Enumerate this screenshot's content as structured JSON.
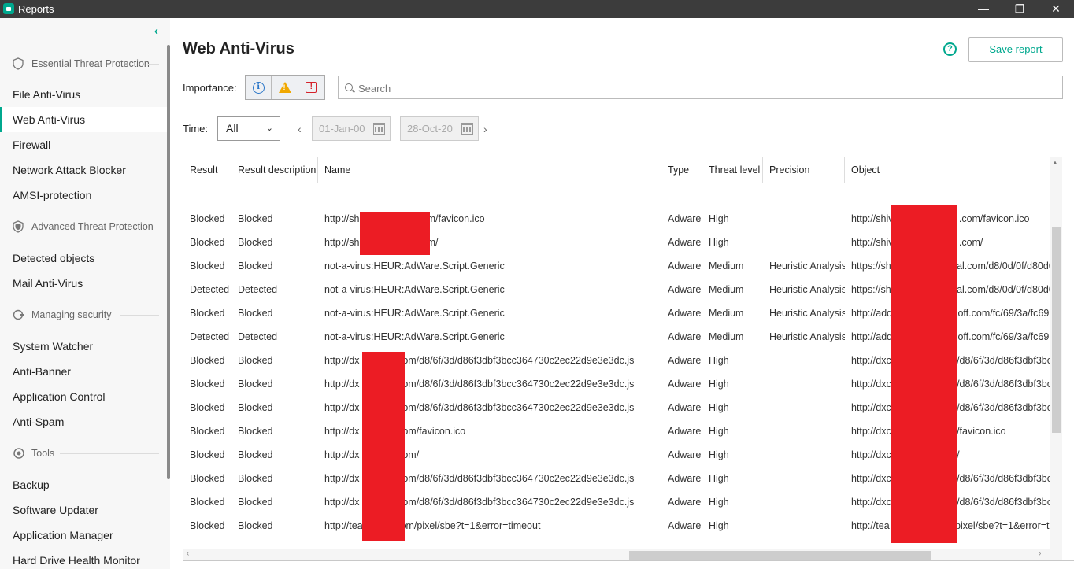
{
  "window": {
    "title": "Reports"
  },
  "sidebar": {
    "sections": [
      {
        "label": "Essential Threat Protection",
        "items": [
          "File Anti-Virus",
          "Web Anti-Virus",
          "Firewall",
          "Network Attack Blocker",
          "AMSI-protection"
        ]
      },
      {
        "label": "Advanced Threat Protection",
        "items": [
          "Detected objects",
          "Mail Anti-Virus"
        ]
      },
      {
        "label": "Managing security",
        "items": [
          "System Watcher",
          "Anti-Banner",
          "Application Control",
          "Anti-Spam"
        ]
      },
      {
        "label": "Tools",
        "items": [
          "Backup",
          "Software Updater",
          "Application Manager",
          "Hard Drive Health Monitor"
        ]
      }
    ],
    "active_item": "Web Anti-Virus"
  },
  "main": {
    "title": "Web Anti-Virus",
    "save_label": "Save report",
    "importance_label": "Importance:",
    "search_placeholder": "Search",
    "time_label": "Time:",
    "time_value": "All",
    "date_from": "01-Jan-00",
    "date_to": "28-Oct-20"
  },
  "table": {
    "columns": [
      "Result",
      "Result description",
      "Name",
      "Type",
      "Threat level",
      "Precision",
      "Object"
    ],
    "rows": [
      [
        "Blocked",
        "Blocked",
        "http://sh                    .com/favicon.ico",
        "Adware",
        "High",
        "",
        "http://shiv                        .com/favicon.ico"
      ],
      [
        "Blocked",
        "Blocked",
        "http://sh                    .com/",
        "Adware",
        "High",
        "",
        "http://shiv                        .com/"
      ],
      [
        "Blocked",
        "Blocked",
        "not-a-virus:HEUR:AdWare.Script.Generic",
        "Adware",
        "Medium",
        "Heuristic Analysis",
        "https://sh                        al.com/d8/0d/0f/d80d0"
      ],
      [
        "Detected",
        "Detected",
        "not-a-virus:HEUR:AdWare.Script.Generic",
        "Adware",
        "Medium",
        "Heuristic Analysis",
        "https://sh                        al.com/d8/0d/0f/d80d0"
      ],
      [
        "Blocked",
        "Blocked",
        "not-a-virus:HEUR:AdWare.Script.Generic",
        "Adware",
        "Medium",
        "Heuristic Analysis",
        "http://add                        off.com/fc/69/3a/fc69"
      ],
      [
        "Detected",
        "Detected",
        "not-a-virus:HEUR:AdWare.Script.Generic",
        "Adware",
        "Medium",
        "Heuristic Analysis",
        "http://add                        off.com/fc/69/3a/fc69"
      ],
      [
        "Blocked",
        "Blocked",
        "http://dx            t.com/d8/6f/3d/d86f3dbf3bcc364730c2ec22d9e3e3dc.js",
        "Adware",
        "High",
        "",
        "http://dxc                        /d8/6f/3d/d86f3dbf3bc"
      ],
      [
        "Blocked",
        "Blocked",
        "http://dx            t.com/d8/6f/3d/d86f3dbf3bcc364730c2ec22d9e3e3dc.js",
        "Adware",
        "High",
        "",
        "http://dxc                        /d8/6f/3d/d86f3dbf3bc"
      ],
      [
        "Blocked",
        "Blocked",
        "http://dx            t.com/d8/6f/3d/d86f3dbf3bcc364730c2ec22d9e3e3dc.js",
        "Adware",
        "High",
        "",
        "http://dxc                        /d8/6f/3d/d86f3dbf3bc"
      ],
      [
        "Blocked",
        "Blocked",
        "http://dx            t.com/favicon.ico",
        "Adware",
        "High",
        "",
        "http://dxc                        /favicon.ico"
      ],
      [
        "Blocked",
        "Blocked",
        "http://dx            t.com/",
        "Adware",
        "High",
        "",
        "http://dxc                        /"
      ],
      [
        "Blocked",
        "Blocked",
        "http://dx            t.com/d8/6f/3d/d86f3dbf3bcc364730c2ec22d9e3e3dc.js",
        "Adware",
        "High",
        "",
        "http://dxc                        /d8/6f/3d/d86f3dbf3bc"
      ],
      [
        "Blocked",
        "Blocked",
        "http://dx            t.com/d8/6f/3d/d86f3dbf3bcc364730c2ec22d9e3e3dc.js",
        "Adware",
        "High",
        "",
        "http://dxc                        /d8/6f/3d/d86f3dbf3bc"
      ],
      [
        "Blocked",
        "Blocked",
        "http://tea            com/pixel/sbe?t=1&error=timeout",
        "Adware",
        "High",
        "",
        "http://tea                        pixel/sbe?t=1&error=ti"
      ]
    ]
  },
  "colors": {
    "accent": "#00a88e",
    "redaction": "#ec1c24",
    "titlebar": "#3c3c3c"
  }
}
